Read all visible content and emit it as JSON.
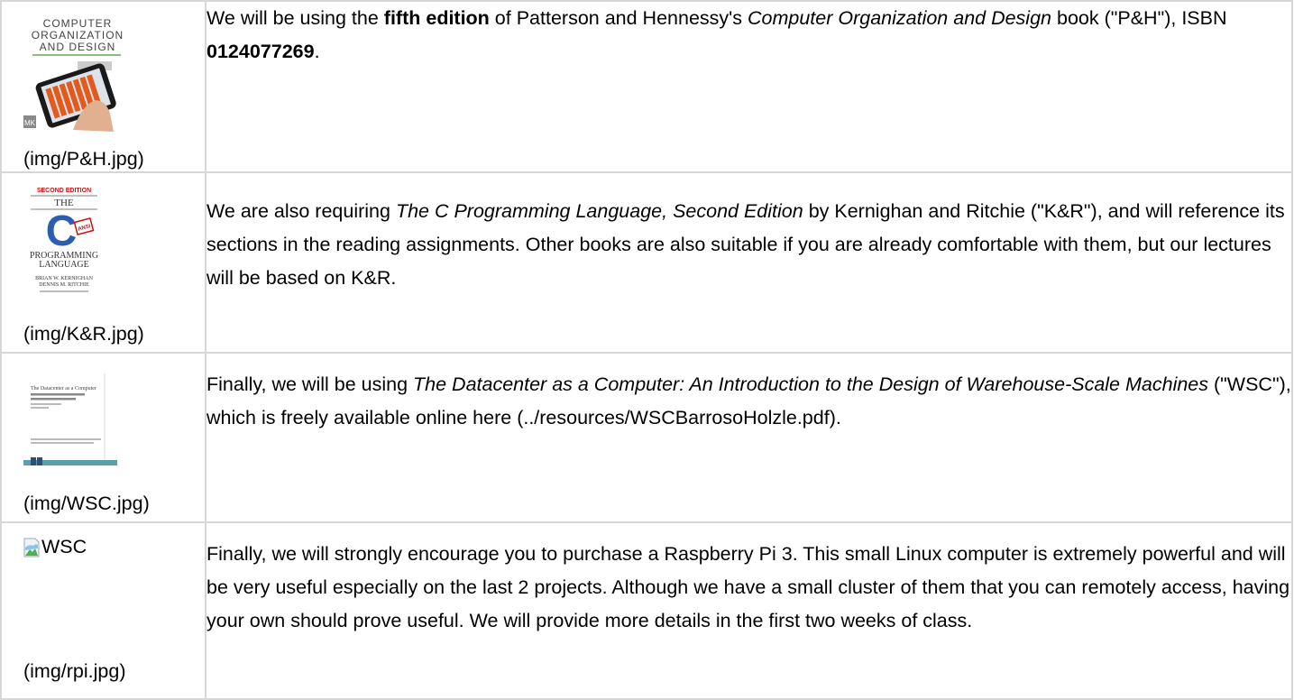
{
  "rows": [
    {
      "caption": "(img/P&H.jpg)",
      "cover": {
        "line1": "COMPUTER",
        "line2": "ORGANIZATION",
        "line3": "AND DESIGN",
        "publisher": "MK"
      },
      "text": {
        "a": "We will be using the ",
        "b": "fifth edition",
        "c": " of Patterson and Hennessy's ",
        "d": "Computer Organization and Design",
        "e": " book (\"P&H\"), ISBN ",
        "f": "0124077269",
        "g": "."
      }
    },
    {
      "caption": "(img/K&R.jpg)",
      "cover": {
        "edition": "SECOND EDITION",
        "the": "THE",
        "letter": "C",
        "ansi": "ANSI",
        "lang1": "PROGRAMMING",
        "lang2": "LANGUAGE",
        "author1": "BRIAN W. KERNIGHAN",
        "author2": "DENNIS M. RITCHIE"
      },
      "text": {
        "a": "We are also requiring ",
        "b": "The C Programming Language, Second Edition",
        "c": " by Kernighan and Ritchie (\"K&R\"), and will reference its sections in the reading assignments. Other books are also suitable if you are already comfortable with them, but our lectures will be based on K&R."
      }
    },
    {
      "caption": "(img/WSC.jpg)",
      "cover": {
        "title": "The Datacenter as a Computer"
      },
      "text": {
        "a": "Finally, we will be using ",
        "b": "The Datacenter as a Computer: An Introduction to the Design of Warehouse-Scale Machines",
        "c": " (\"WSC\"), which is freely available online here (../resources/WSCBarrosoHolzle.pdf)."
      }
    },
    {
      "caption": "(img/rpi.jpg)",
      "alt": "WSC",
      "text": {
        "a": "Finally, we will strongly encourage you to purchase a Raspberry Pi 3. This small Linux computer is extremely powerful and will be very useful especially on the last 2 projects. Although we have a small cluster of them that you can remotely access, having your own should prove useful. We will provide more details in the first two weeks of class."
      }
    }
  ],
  "colors": {
    "border": "#d6d6d6",
    "text": "#000000"
  }
}
